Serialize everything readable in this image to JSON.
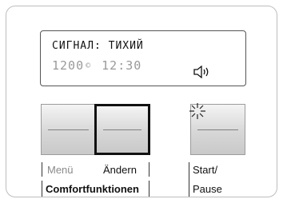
{
  "display": {
    "line1": "СИГНАЛ: ТИХИЙ",
    "temperature": "1200",
    "degree_symbol": "©",
    "time": "12:30",
    "sound_icon": "speaker-icon"
  },
  "buttons": {
    "menu_label": "Menü",
    "change_label": "Ändern",
    "comfort_label": "Comfortfunktionen",
    "start_label": "Start/",
    "pause_label": "Pause",
    "start_icon": "sunburst-icon"
  },
  "colors": {
    "panel_border": "#bdbdbd",
    "lcd_active": "#111111",
    "lcd_dim": "#9a9a9a",
    "selected_border": "#111111"
  }
}
